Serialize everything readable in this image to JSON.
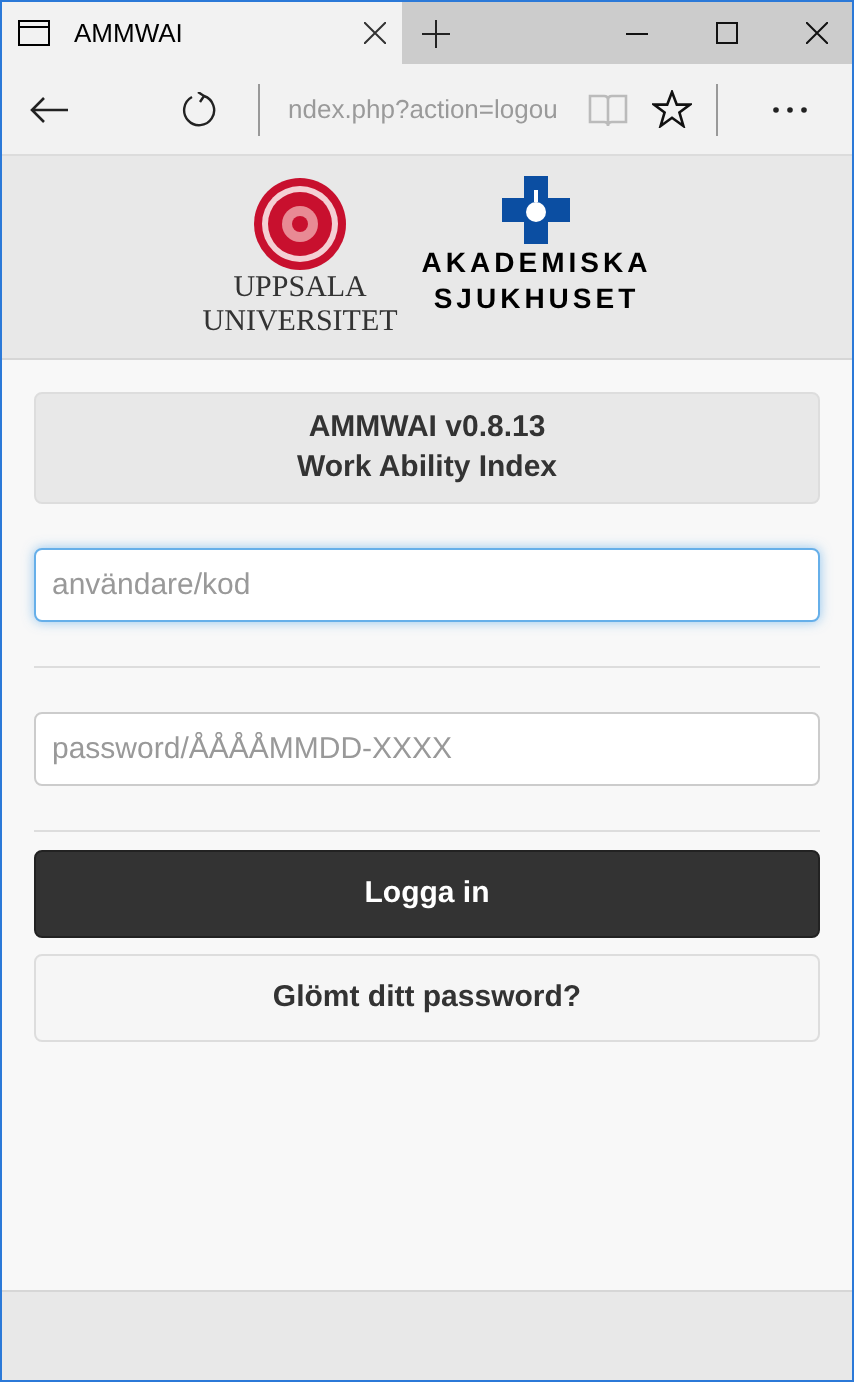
{
  "browser": {
    "tab_title": "AMMWAI",
    "address": "ndex.php?action=logou"
  },
  "header": {
    "logo_left": [
      "UPPSALA",
      "UNIVERSITET"
    ],
    "logo_right": [
      "AKADEMISKA",
      "SJUKHUSET"
    ]
  },
  "banner": {
    "title": "AMMWAI v0.8.13",
    "subtitle": "Work Ability Index"
  },
  "fields": [
    {
      "placeholder": "användare/kod",
      "focused": true
    },
    {
      "placeholder": "password/ÅÅÅÅMMDD-XXXX",
      "focused": false
    }
  ],
  "buttons": [
    {
      "label": "Logga in",
      "kind": "primary"
    },
    {
      "label": "Glömt ditt password?",
      "kind": "secondary"
    }
  ]
}
